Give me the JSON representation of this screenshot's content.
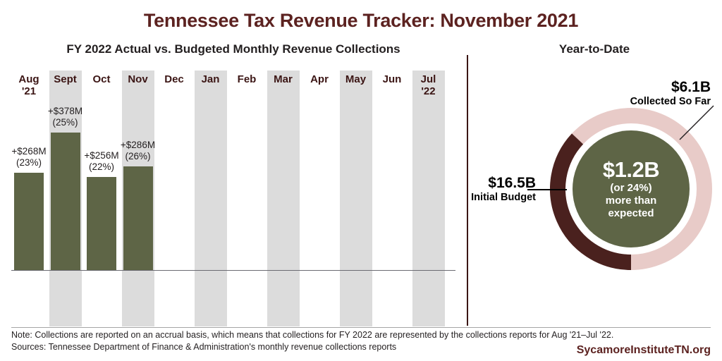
{
  "title": "Tennessee Tax Revenue Tracker: November 2021",
  "panels": {
    "bar_title": "FY 2022 Actual vs. Budgeted Monthly Revenue Collections",
    "ytd_title": "Year-to-Date"
  },
  "chart_data": [
    {
      "type": "bar",
      "title": "FY 2022 Actual vs. Budgeted Monthly Revenue Collections",
      "xlabel": "",
      "ylabel": "",
      "grid": false,
      "legend": "none",
      "categories": [
        "Aug '21",
        "Sept",
        "Oct",
        "Nov",
        "Dec",
        "Jan",
        "Feb",
        "Mar",
        "Apr",
        "May",
        "Jun",
        "Jul '22"
      ],
      "months": [
        {
          "label": "Aug",
          "year": "'21",
          "amount": "+$268M",
          "percent": "(23%)",
          "value_millions": 268,
          "percent_value": 23,
          "has_bar": true,
          "shaded": false
        },
        {
          "label": "Sept",
          "year": "",
          "amount": "+$378M",
          "percent": "(25%)",
          "value_millions": 378,
          "percent_value": 25,
          "has_bar": true,
          "shaded": true
        },
        {
          "label": "Oct",
          "year": "",
          "amount": "+$256M",
          "percent": "(22%)",
          "value_millions": 256,
          "percent_value": 22,
          "has_bar": true,
          "shaded": false
        },
        {
          "label": "Nov",
          "year": "",
          "amount": "+$286M",
          "percent": "(26%)",
          "value_millions": 286,
          "percent_value": 26,
          "has_bar": true,
          "shaded": true
        },
        {
          "label": "Dec",
          "year": "",
          "amount": "",
          "percent": "",
          "value_millions": null,
          "percent_value": null,
          "has_bar": false,
          "shaded": false
        },
        {
          "label": "Jan",
          "year": "",
          "amount": "",
          "percent": "",
          "value_millions": null,
          "percent_value": null,
          "has_bar": false,
          "shaded": true
        },
        {
          "label": "Feb",
          "year": "",
          "amount": "",
          "percent": "",
          "value_millions": null,
          "percent_value": null,
          "has_bar": false,
          "shaded": false
        },
        {
          "label": "Mar",
          "year": "",
          "amount": "",
          "percent": "",
          "value_millions": null,
          "percent_value": null,
          "has_bar": false,
          "shaded": true
        },
        {
          "label": "Apr",
          "year": "",
          "amount": "",
          "percent": "",
          "value_millions": null,
          "percent_value": null,
          "has_bar": false,
          "shaded": false
        },
        {
          "label": "May",
          "year": "",
          "amount": "",
          "percent": "",
          "value_millions": null,
          "percent_value": null,
          "has_bar": false,
          "shaded": true
        },
        {
          "label": "Jun",
          "year": "",
          "amount": "",
          "percent": "",
          "value_millions": null,
          "percent_value": null,
          "has_bar": false,
          "shaded": false
        },
        {
          "label": "Jul",
          "year": "'22",
          "amount": "",
          "percent": "",
          "value_millions": null,
          "percent_value": null,
          "has_bar": false,
          "shaded": true
        }
      ],
      "bar_color": "#5E6546",
      "band_color": "#DCDCDC"
    },
    {
      "type": "pie",
      "title": "Year-to-Date",
      "center_value": "$1.2B",
      "center_line2": "(or 24%)",
      "center_line3": "more than",
      "center_line4": "expected",
      "categories": [
        "Collected So Far",
        "Initial Budget"
      ],
      "values": [
        6.1,
        16.5
      ],
      "unit": "billions of dollars",
      "slices": [
        {
          "name": "Collected So Far",
          "value": "$6.1B",
          "value_numeric": 6.1,
          "color": "#4A211E",
          "fraction_of_budget": 0.37
        },
        {
          "name": "Initial Budget",
          "value": "$16.5B",
          "value_numeric": 16.5,
          "color": "#E8CBC8",
          "fraction_of_budget": 1.0
        }
      ],
      "callouts": [
        {
          "value": "$6.1B",
          "label": "Collected So Far"
        },
        {
          "value": "$16.5B",
          "label": "Initial Budget"
        }
      ]
    }
  ],
  "footer": {
    "note": "Note: Collections are reported on an accrual basis, which means that collections for FY 2022 are represented by the collections reports for Aug '21–Jul '22.",
    "sources": "Sources: Tennessee Department of Finance & Administration's monthly revenue collections reports",
    "brand": "SycamoreInstituteTN.org"
  },
  "colors": {
    "title": "#5C2220",
    "bar": "#5E6546",
    "band": "#DCDCDC",
    "ring_dark": "#4A211E",
    "ring_light": "#E8CBC8",
    "center_fill": "#5E6546"
  }
}
